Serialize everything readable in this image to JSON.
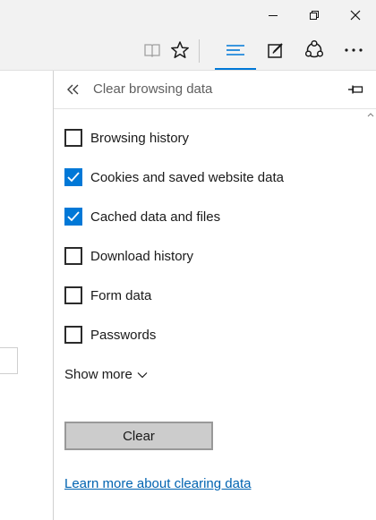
{
  "window_controls": {
    "minimize": "minimize-icon",
    "restore": "restore-icon",
    "close": "close-icon"
  },
  "toolbar": {
    "icons": [
      "reading-view-icon",
      "favorite-star-icon",
      "hub-icon",
      "web-note-icon",
      "share-icon",
      "more-icon"
    ],
    "active": "hub-icon",
    "accent": "#0078d7"
  },
  "panel": {
    "title": "Clear browsing data",
    "options": [
      {
        "label": "Browsing history",
        "checked": false
      },
      {
        "label": "Cookies and saved website data",
        "checked": true
      },
      {
        "label": "Cached data and files",
        "checked": true
      },
      {
        "label": "Download history",
        "checked": false
      },
      {
        "label": "Form data",
        "checked": false
      },
      {
        "label": "Passwords",
        "checked": false
      }
    ],
    "show_more": "Show more",
    "clear_button": "Clear",
    "learn_more_link": "Learn more about clearing data"
  }
}
